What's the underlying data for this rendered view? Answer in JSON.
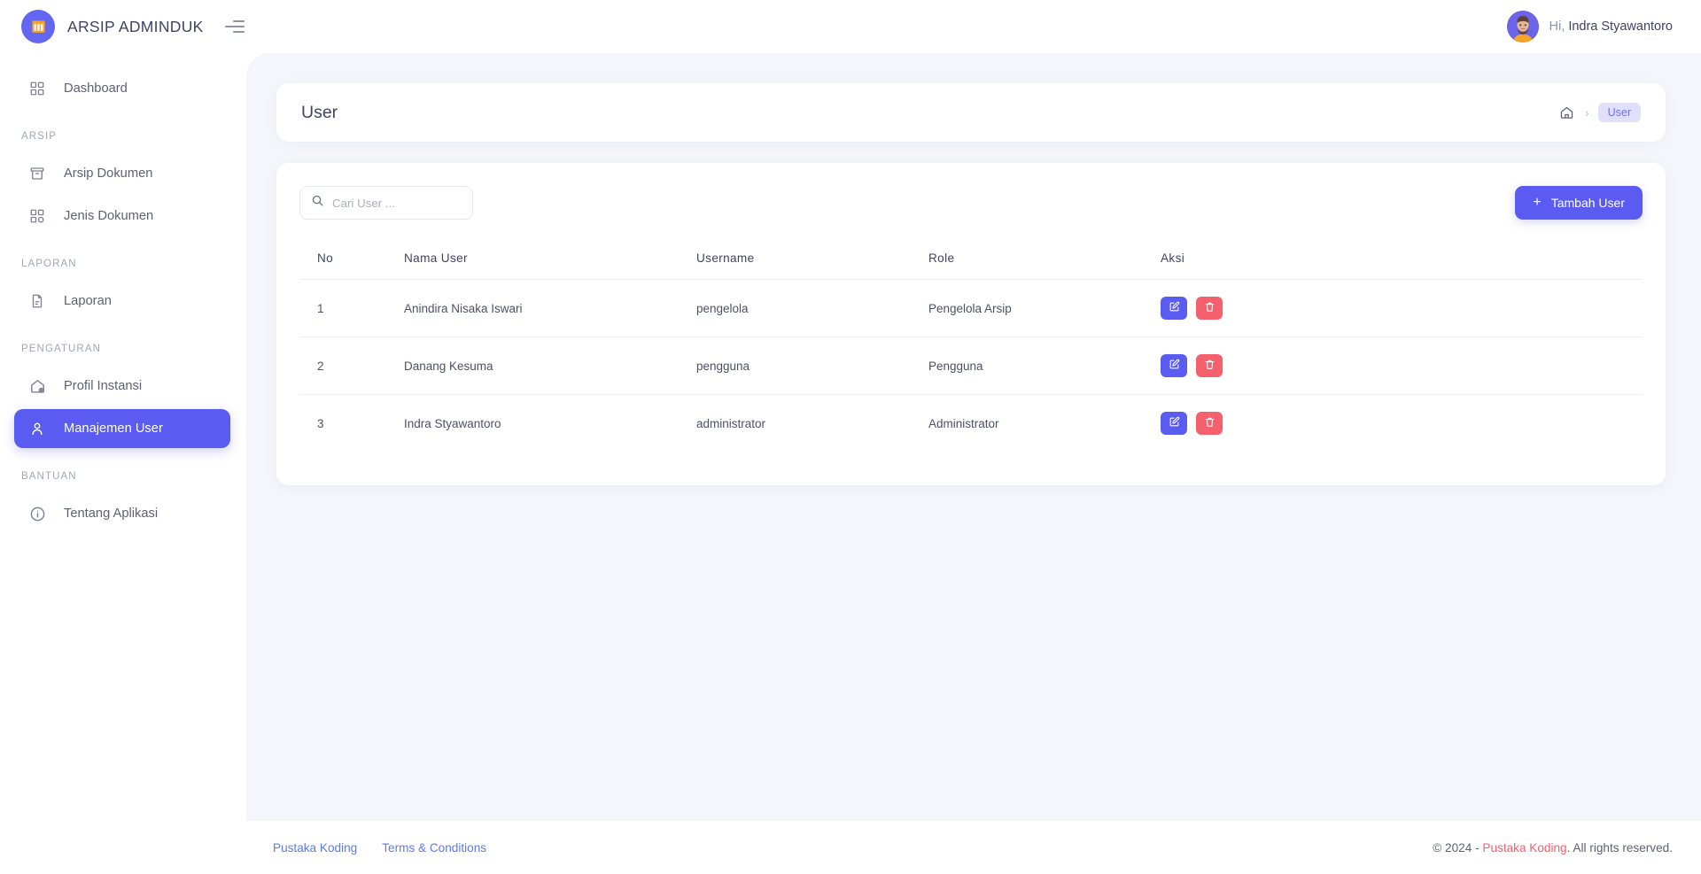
{
  "brand": {
    "title": "ARSIP ADMINDUK",
    "logo_icon": "archive-books-icon",
    "toggle_icon": "hamburger-menu-icon",
    "logo_color": "#6366f1",
    "accent_color": "#5a5bf0"
  },
  "topbar": {
    "greeting_prefix": "Hi,",
    "user_name": "Indra Styawantoro",
    "avatar_icon": "user-avatar"
  },
  "sidebar": {
    "groups": [
      {
        "label": "",
        "items": [
          {
            "label": "Dashboard",
            "icon": "grid-dashboard-icon",
            "active": false
          }
        ]
      },
      {
        "label": "ARSIP",
        "items": [
          {
            "label": "Arsip Dokumen",
            "icon": "archive-box-icon",
            "active": false
          },
          {
            "label": "Jenis Dokumen",
            "icon": "grid-categories-icon",
            "active": false
          }
        ]
      },
      {
        "label": "LAPORAN",
        "items": [
          {
            "label": "Laporan",
            "icon": "document-report-icon",
            "active": false
          }
        ]
      },
      {
        "label": "PENGATURAN",
        "items": [
          {
            "label": "Profil Instansi",
            "icon": "home-settings-icon",
            "active": false
          },
          {
            "label": "Manajemen User",
            "icon": "user-person-icon",
            "active": true
          }
        ]
      },
      {
        "label": "BANTUAN",
        "items": [
          {
            "label": "Tentang Aplikasi",
            "icon": "info-circle-icon",
            "active": false
          }
        ]
      }
    ]
  },
  "page": {
    "title": "User",
    "breadcrumb": {
      "home_icon": "home-icon",
      "separator": "›",
      "current": "User"
    }
  },
  "toolbar": {
    "search_placeholder": "Cari User ...",
    "search_value": "",
    "search_icon": "search-icon",
    "add_button_label": "Tambah User",
    "add_button_icon": "plus-icon"
  },
  "table": {
    "columns": [
      "No",
      "Nama User",
      "Username",
      "Role",
      "Aksi"
    ],
    "rows": [
      {
        "no": "1",
        "nama": "Anindira Nisaka Iswari",
        "username": "pengelola",
        "role": "Pengelola Arsip",
        "edit_icon": "edit-pencil-icon",
        "delete_icon": "trash-icon"
      },
      {
        "no": "2",
        "nama": "Danang Kesuma",
        "username": "pengguna",
        "role": "Pengguna",
        "edit_icon": "edit-pencil-icon",
        "delete_icon": "trash-icon"
      },
      {
        "no": "3",
        "nama": "Indra Styawantoro",
        "username": "administrator",
        "role": "Administrator",
        "edit_icon": "edit-pencil-icon",
        "delete_icon": "trash-icon"
      }
    ]
  },
  "footer": {
    "links": [
      "Pustaka Koding",
      "Terms & Conditions"
    ],
    "copyright_prefix": "© 2024 - ",
    "copyright_brand": "Pustaka Koding",
    "copyright_suffix": ". All rights reserved."
  }
}
